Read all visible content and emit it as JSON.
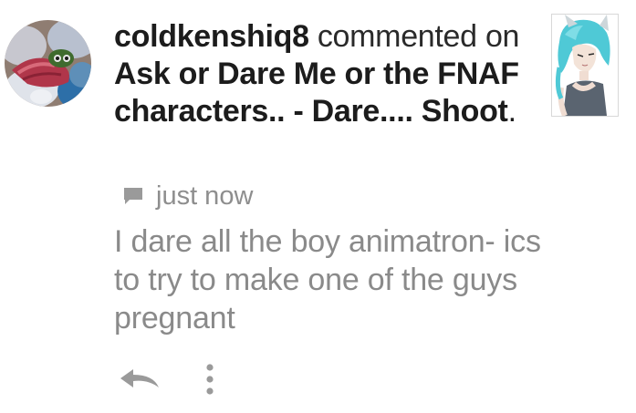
{
  "notification": {
    "username": "coldkenshiq8",
    "action": "commented",
    "preposition": "on",
    "post_title": "Ask or Dare Me or the FNAF characters.. - Dare.... Shoot",
    "trailing_punctuation": ".",
    "timestamp": "just now",
    "comment": "I dare all the boy animatron- ics to try to make one of the guys pregnant"
  },
  "icons": {
    "avatar": "user-avatar-plush",
    "thumbnail": "post-thumbnail-anime-character",
    "comment": "speech-bubble-icon",
    "reply": "reply-arrow-icon",
    "more": "vertical-dots-icon"
  },
  "colors": {
    "headline": "#1c1c1c",
    "meta": "#8e8e8e",
    "comment_text": "#8a8a8a",
    "icon": "#9a9a9a"
  }
}
